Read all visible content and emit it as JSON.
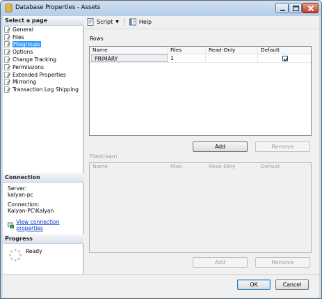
{
  "window": {
    "title": "Database Properties - Assets"
  },
  "left_pane": {
    "select_page_header": "Select a page",
    "pages": [
      {
        "label": "General",
        "selected": false
      },
      {
        "label": "Files",
        "selected": false
      },
      {
        "label": "Filegroups",
        "selected": true
      },
      {
        "label": "Options",
        "selected": false
      },
      {
        "label": "Change Tracking",
        "selected": false
      },
      {
        "label": "Permissions",
        "selected": false
      },
      {
        "label": "Extended Properties",
        "selected": false
      },
      {
        "label": "Mirroring",
        "selected": false
      },
      {
        "label": "Transaction Log Shipping",
        "selected": false
      }
    ],
    "connection_header": "Connection",
    "server_label": "Server:",
    "server_value": "kalyan-pc",
    "connection_label": "Connection:",
    "connection_value": "Kalyan-PC\\Kalyan",
    "view_connection_link": "View connection properties",
    "progress_header": "Progress",
    "progress_status": "Ready"
  },
  "toolbar": {
    "script_label": "Script",
    "help_label": "Help"
  },
  "rows_section": {
    "label": "Rows",
    "columns": [
      "Name",
      "Files",
      "Read-Only",
      "Default"
    ],
    "rows": [
      {
        "name": "PRIMARY",
        "files": "1",
        "read_only": "",
        "default": true
      }
    ],
    "add_label": "Add",
    "remove_label": "Remove"
  },
  "filestream_section": {
    "label": "Filestream",
    "columns": [
      "Name",
      "Files",
      "Read-Only",
      "Default"
    ],
    "add_label": "Add",
    "remove_label": "Remove"
  },
  "footer": {
    "ok_label": "OK",
    "cancel_label": "Cancel"
  }
}
